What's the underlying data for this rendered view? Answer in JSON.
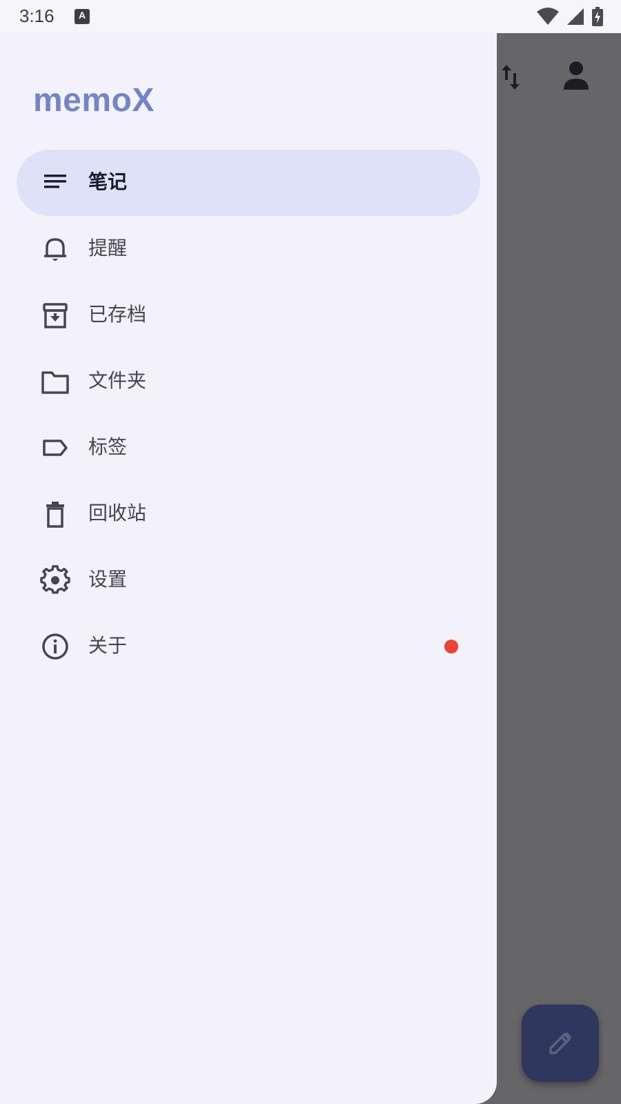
{
  "status_bar": {
    "time": "3:16",
    "keyboard_indicator": "A",
    "icons": [
      "wifi-icon",
      "cell-signal-icon",
      "battery-charging-icon"
    ]
  },
  "drawer": {
    "brand": "memoX",
    "items": [
      {
        "label": "笔记",
        "icon": "notes-icon",
        "active": true
      },
      {
        "label": "提醒",
        "icon": "bell-icon",
        "active": false
      },
      {
        "label": "已存档",
        "icon": "archive-icon",
        "active": false
      },
      {
        "label": "文件夹",
        "icon": "folder-icon",
        "active": false
      },
      {
        "label": "标签",
        "icon": "label-icon",
        "active": false
      },
      {
        "label": "回收站",
        "icon": "trash-icon",
        "active": false
      },
      {
        "label": "设置",
        "icon": "settings-icon",
        "active": false
      },
      {
        "label": "关于",
        "icon": "info-icon",
        "active": false,
        "badge": true
      }
    ]
  },
  "app_bar": {
    "icons": [
      "sort-icon",
      "account-icon"
    ]
  },
  "fab": {
    "icon": "edit-pencil-icon"
  },
  "colors": {
    "brand": "#7384c9",
    "active_bg": "#dfe1f8",
    "drawer_bg": "#f3f2fa",
    "scrim": "#666668",
    "badge": "#ef4135",
    "fab": "#30375e"
  }
}
